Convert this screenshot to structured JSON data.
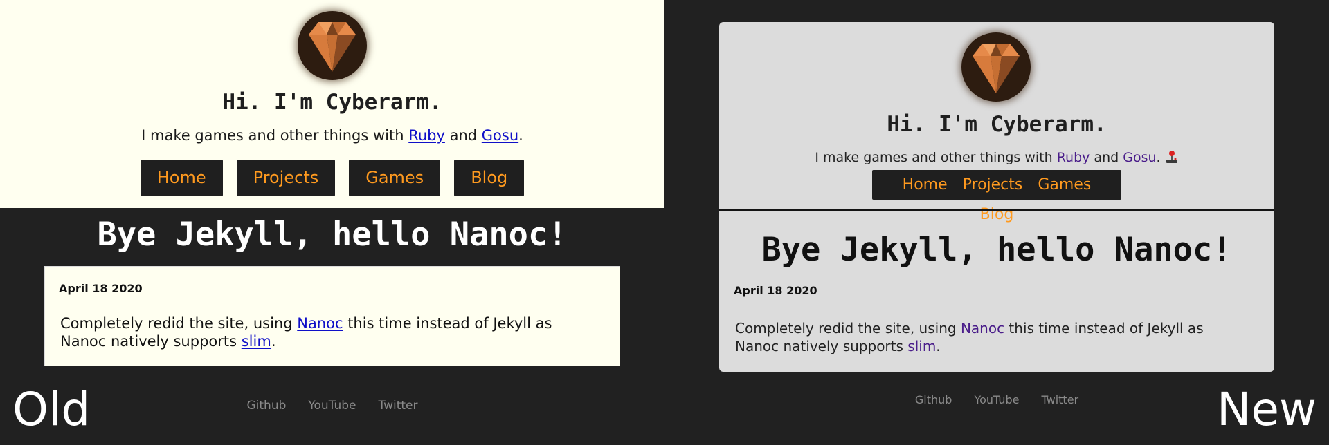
{
  "colors": {
    "page_background": "#212121",
    "old_header_background": "#fffff0",
    "new_card_background": "#dcdcdc",
    "nav_background": "#1f1f1f",
    "nav_text": "#ff9a1f",
    "old_link": "#1010c8",
    "new_link": "#4a1d8a",
    "footer_link": "#8a8a8a"
  },
  "old": {
    "avatar_icon": "diamond-gem-icon",
    "title": "Hi. I'm Cyberarm.",
    "tagline": {
      "prefix": "I make games and other things with ",
      "link1": "Ruby",
      "middle": " and ",
      "link2": "Gosu",
      "suffix": "."
    },
    "nav": [
      "Home",
      "Projects",
      "Games",
      "Blog"
    ],
    "post": {
      "title": "Bye Jekyll, hello Nanoc!",
      "date": "April 18 2020",
      "body_prefix": "Completely redid the site, using ",
      "link1": "Nanoc",
      "body_middle": " this time instead of Jekyll as Nanoc natively supports ",
      "link2": "slim",
      "body_suffix": "."
    },
    "footer": [
      "Github",
      "YouTube",
      "Twitter"
    ],
    "label": "Old"
  },
  "new": {
    "avatar_icon": "diamond-gem-icon",
    "title": "Hi. I'm Cyberarm.",
    "tagline": {
      "prefix": "I make games and other things with ",
      "link1": "Ruby",
      "middle": " and ",
      "link2": "Gosu",
      "suffix": ". ",
      "emoji_icon": "joystick-icon"
    },
    "nav": [
      "Home",
      "Projects",
      "Games",
      "Blog"
    ],
    "post": {
      "title": "Bye Jekyll, hello Nanoc!",
      "date": "April 18 2020",
      "body_prefix": "Completely redid the site, using ",
      "link1": "Nanoc",
      "body_middle": " this time instead of Jekyll as Nanoc natively supports ",
      "link2": "slim",
      "body_suffix": "."
    },
    "footer": [
      "Github",
      "YouTube",
      "Twitter"
    ],
    "label": "New"
  }
}
